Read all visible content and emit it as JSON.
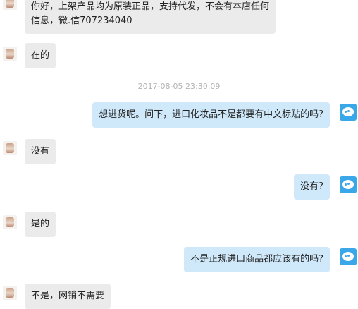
{
  "conversation": {
    "messages": [
      {
        "from": "seller",
        "text_line1": "你好，上架产品均为原装正品，支持代发，不会有本店任何",
        "text_line2": "信息，微.信707234040"
      },
      {
        "from": "seller",
        "text": "在的"
      },
      {
        "type": "timestamp",
        "text": "2017-08-05 23:30:09"
      },
      {
        "from": "buyer",
        "text": "想进货呢。问下，进口化妆品不是都要有中文标贴的吗?"
      },
      {
        "from": "seller",
        "text": "没有"
      },
      {
        "from": "buyer",
        "text": "没有?"
      },
      {
        "from": "seller",
        "text": "是的"
      },
      {
        "from": "buyer",
        "text": "不是正规进口商品都应该有的吗?"
      },
      {
        "from": "seller",
        "text": "不是，网销不需要"
      }
    ]
  },
  "colors": {
    "seller_bubble": "#ebebeb",
    "buyer_bubble": "#cfe9fb",
    "buyer_avatar": "#3aa7e8",
    "timestamp": "#b3b3b3"
  },
  "icons": {
    "seller_avatar": "seller-avatar-icon",
    "buyer_avatar": "buyer-avatar-icon"
  }
}
